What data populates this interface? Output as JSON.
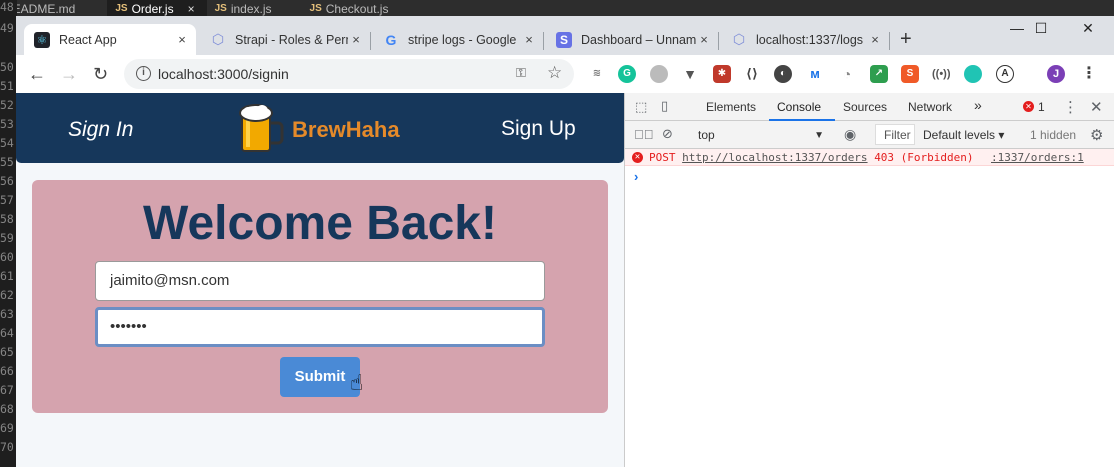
{
  "editor": {
    "tabs": [
      {
        "badge": "",
        "label": "README.md"
      },
      {
        "badge": "JS",
        "label": "Order.js",
        "close": "×"
      },
      {
        "badge": "JS",
        "label": "index.js"
      },
      {
        "badge": "JS",
        "label": "Checkout.js"
      }
    ],
    "line_numbers": [
      "48",
      "49",
      "50",
      "51",
      "52",
      "53",
      "54",
      "55",
      "56",
      "57",
      "58",
      "59",
      "60",
      "61",
      "62",
      "63",
      "64",
      "65",
      "66",
      "67",
      "68",
      "69",
      "70"
    ]
  },
  "browser": {
    "tabs": [
      {
        "title": "React App",
        "close": "×",
        "icon": "react-icon",
        "color": "#61dafb"
      },
      {
        "title": "Strapi - Roles & Perm",
        "close": "×",
        "icon": "strapi-icon",
        "color": "#7f8ed8"
      },
      {
        "title": "stripe logs - Google",
        "close": "×",
        "icon": "google-icon",
        "color": "#4285f4"
      },
      {
        "title": "Dashboard – Unnam",
        "close": "×",
        "icon": "stripe-icon",
        "color": "#6772e5"
      },
      {
        "title": "localhost:1337/logs",
        "close": "×",
        "icon": "strapi-icon",
        "color": "#7f8ed8"
      }
    ],
    "new_tab": "+",
    "window_controls": {
      "minimize": "—",
      "maximize": "☐",
      "close": "✕"
    },
    "url": "localhost:3000/signin",
    "profile_initial": "J"
  },
  "app": {
    "nav_signin": "Sign In",
    "brand": "BrewHaha",
    "nav_signup": "Sign Up",
    "heading": "Welcome Back!",
    "email_value": "jaimito@msn.com",
    "password_value": "•••••••",
    "submit_label": "Submit",
    "colors": {
      "navbar": "#16375b",
      "brand": "#e58a2a",
      "card": "#d5a3ae",
      "button": "#4a8ad6"
    }
  },
  "devtools": {
    "tabs": [
      "Elements",
      "Console",
      "Sources",
      "Network"
    ],
    "active_tab": "Console",
    "more": "»",
    "error_count": "1",
    "context": "top",
    "filter_placeholder": "Filter",
    "levels": "Default levels ▾",
    "hidden": "1 hidden",
    "error": {
      "method": "POST",
      "url": "http://localhost:1337/orders",
      "status": "403 (Forbidden)",
      "source": ":1337/orders:1"
    },
    "prompt": "›"
  }
}
